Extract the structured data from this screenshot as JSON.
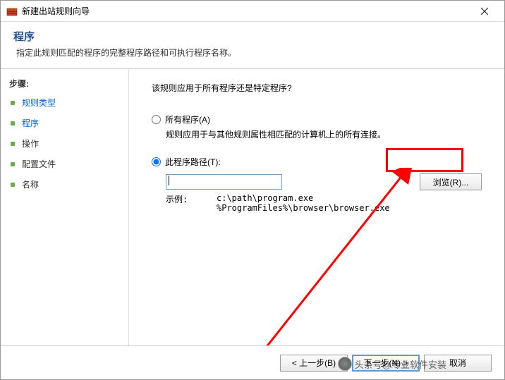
{
  "titlebar": {
    "text": "新建出站规则向导"
  },
  "header": {
    "title": "程序",
    "desc": "指定此规则匹配的程序的完整程序路径和可执行程序名称。"
  },
  "sidebar": {
    "title": "步骤:",
    "items": [
      {
        "label": "规则类型"
      },
      {
        "label": "程序"
      },
      {
        "label": "操作"
      },
      {
        "label": "配置文件"
      },
      {
        "label": "名称"
      }
    ]
  },
  "content": {
    "question": "该规则应用于所有程序还是特定程序?",
    "allPrograms": {
      "label": "所有程序(A)",
      "desc": "规则应用于与其他规则属性相匹配的计算机上的所有连接。"
    },
    "thisProgram": {
      "label": "此程序路径(T):",
      "pathValue": "",
      "browse": "浏览(R)..."
    },
    "example": {
      "label": "示例:",
      "text": "c:\\path\\program.exe\n%ProgramFiles%\\browser\\browser.exe"
    }
  },
  "footer": {
    "back": "< 上一步(B)",
    "next": "下一步(N) >",
    "cancel": "取消"
  },
  "watermark": "头条号@专业软件安装"
}
